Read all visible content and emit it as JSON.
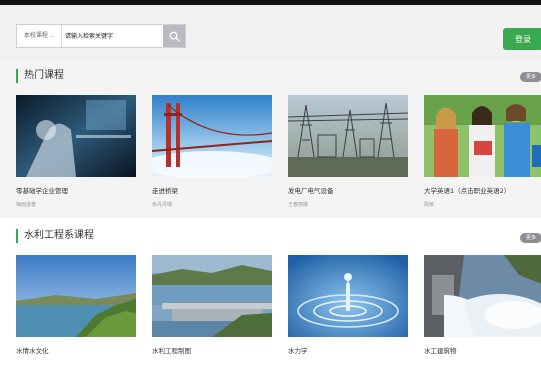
{
  "header": {
    "search_scope": "本校课程",
    "search_placeholder": "请输入检索关键字",
    "search_icon": "search-icon",
    "login_label": "登录"
  },
  "sections": [
    {
      "title": "热门课程",
      "more": "更多",
      "courses": [
        {
          "title": "零基础学企业管理",
          "sub": "梅雨凌春"
        },
        {
          "title": "走进桥梁",
          "sub": "余丹丹瑞"
        },
        {
          "title": "发电厂电气设备",
          "sub": "王春丽娜"
        },
        {
          "title": "大学英语1（点击职业英语2）",
          "sub": "陈敏"
        }
      ]
    },
    {
      "title": "水利工程系课程",
      "more": "更多",
      "courses": [
        {
          "title": "水情水文化"
        },
        {
          "title": "水利工程制图"
        },
        {
          "title": "水力学"
        },
        {
          "title": "水工建筑物"
        }
      ]
    }
  ],
  "colors": {
    "accent_green": "#3aa84f",
    "more_badge": "#8b8f95"
  }
}
